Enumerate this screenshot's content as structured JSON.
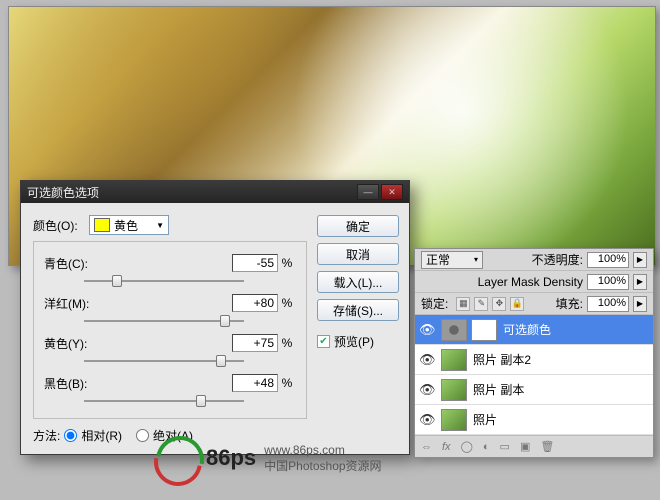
{
  "dialog": {
    "title": "可选颜色选项",
    "color_label": "颜色(O):",
    "color_value": "黄色",
    "sliders": {
      "cyan_label": "青色(C):",
      "cyan_value": "-55",
      "magenta_label": "洋红(M):",
      "magenta_value": "+80",
      "yellow_label": "黄色(Y):",
      "yellow_value": "+75",
      "black_label": "黑色(B):",
      "black_value": "+48"
    },
    "pct": "%",
    "method_label": "方法:",
    "relative_label": "相对(R)",
    "absolute_label": "绝对(A)",
    "buttons": {
      "ok": "确定",
      "cancel": "取消",
      "load": "载入(L)...",
      "save": "存储(S)..."
    },
    "preview_label": "预览(P)"
  },
  "layers": {
    "blend_value": "正常",
    "opacity_label": "不透明度:",
    "opacity_value": "100%",
    "density_label": "Layer Mask Density",
    "density_value": "100%",
    "lock_label": "锁定:",
    "fill_label": "填充:",
    "fill_value": "100%",
    "items": [
      {
        "name": "可选颜色",
        "selected": true,
        "adjustment": true
      },
      {
        "name": "照片 副本2",
        "selected": false,
        "adjustment": false
      },
      {
        "name": "照片 副本",
        "selected": false,
        "adjustment": false
      },
      {
        "name": "照片",
        "selected": false,
        "adjustment": false
      }
    ],
    "footer_icons": [
      "⇔",
      "fx",
      "○",
      "◐",
      "□",
      "▣",
      "🗑"
    ]
  },
  "watermark": {
    "name": "86ps",
    "url": "www.86ps.com",
    "tagline": "中国Photoshop资源网"
  }
}
